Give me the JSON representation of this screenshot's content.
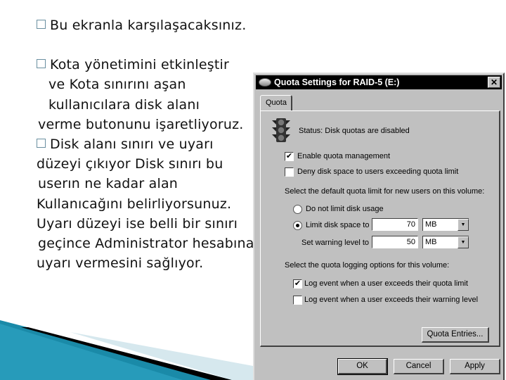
{
  "slide": {
    "bullets": [
      {
        "lines": [
          "Bu ekranla karşılaşacaksınız."
        ]
      },
      {
        "lines": [
          "Kota yönetimini etkinleştir",
          " ve Kota sınırını aşan",
          " kullanıcılara disk alanı",
          "verme butonunu işaretliyoruz."
        ]
      },
      {
        "lines": [
          "Disk alanı sınırı ve uyarı",
          "düzeyi çıkıyor Disk sınırı bu",
          " userın ne kadar alan",
          "Kullanıcağını belirliyorsunuz.",
          "Uyarı düzeyi ise belli bir sınırı",
          " geçince Administrator hesabına",
          "uyarı vermesini sağlıyor."
        ]
      }
    ]
  },
  "dialog": {
    "title": "Quota Settings for RAID-5 (E:)",
    "close_icon": "close-icon",
    "tab": "Quota",
    "status_icon": "traffic-light-icon",
    "status": "Status:  Disk quotas are disabled",
    "enable_quota": {
      "label": "Enable quota management",
      "checked": true
    },
    "deny_space": {
      "label": "Deny disk space to users exceeding quota limit",
      "checked": false
    },
    "default_limit_heading": "Select the default quota limit for new users on this volume:",
    "no_limit": {
      "label": "Do not limit disk usage",
      "selected": false
    },
    "limit_space": {
      "label": "Limit disk space to",
      "selected": true,
      "value": "70",
      "unit": "MB"
    },
    "warning_level": {
      "label": "Set warning level to",
      "value": "50",
      "unit": "MB"
    },
    "logging_heading": "Select the quota logging options for this volume:",
    "log_limit": {
      "label": "Log event when a user exceeds their quota limit",
      "checked": true
    },
    "log_warning": {
      "label": "Log event when a user exceeds their warning level",
      "checked": false
    },
    "quota_entries_button": "Quota Entries...",
    "ok_button": "OK",
    "cancel_button": "Cancel",
    "apply_button": "Apply"
  }
}
